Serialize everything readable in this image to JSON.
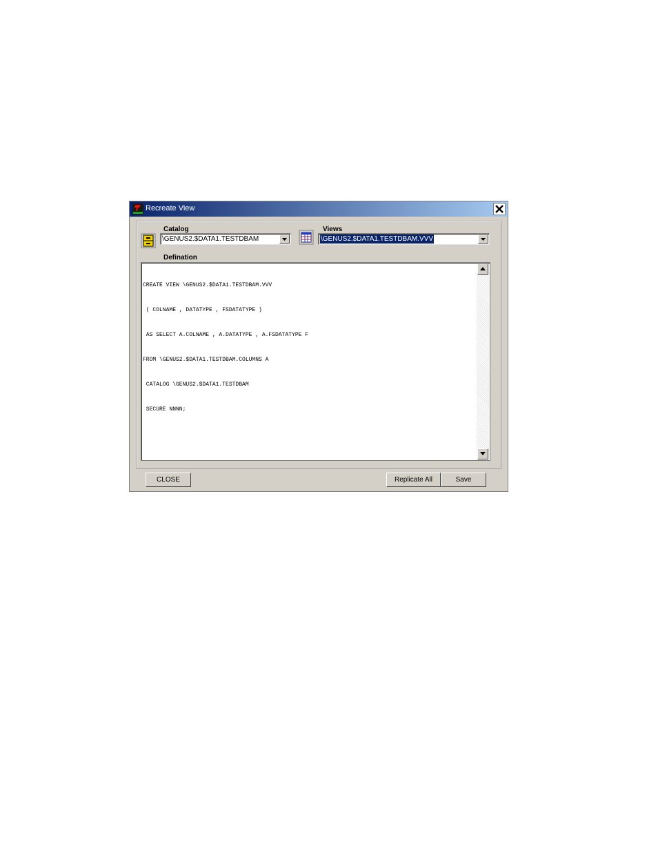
{
  "window": {
    "title": "Recreate View",
    "app_icon": "tandem-logo-icon",
    "close_icon": "close-icon"
  },
  "catalog": {
    "label": "Catalog",
    "value": "\\GENUS2.$DATA1.TESTDBAM",
    "icon": "cabinet-icon"
  },
  "views": {
    "label": "Views",
    "value": "\\GENUS2.$DATA1.TESTDBAM.VVV",
    "icon": "table-grid-icon"
  },
  "definition": {
    "label": "Defination",
    "lines": [
      "CREATE VIEW \\GENUS2.$DATA1.TESTDBAM.VVV",
      " ( COLNAME , DATATYPE , FSDATATYPE )",
      " AS SELECT A.COLNAME , A.DATATYPE , A.FSDATATYPE F",
      "FROM \\GENUS2.$DATA1.TESTDBAM.COLUMNS A",
      " CATALOG \\GENUS2.$DATA1.TESTDBAM",
      " SECURE NNNN;"
    ]
  },
  "buttons": {
    "close": "CLOSE",
    "replicate_all": "Replicate All",
    "save": "Save"
  },
  "colors": {
    "titlebar_start": "#0a246a",
    "titlebar_end": "#a6caf0",
    "dialog_bg": "#d4d0c8",
    "selection": "#0a246a"
  }
}
